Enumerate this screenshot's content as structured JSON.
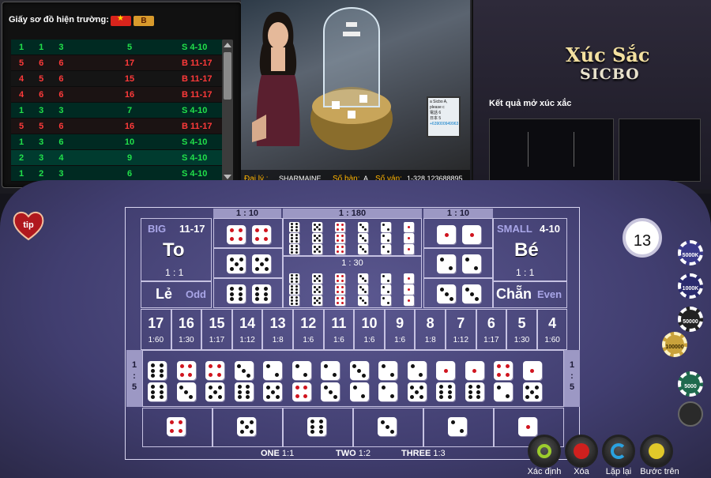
{
  "roadmap": {
    "title": "Giấy sơ đồ hiện trường:",
    "flag_b": "B",
    "rows": [
      {
        "dice": "1 1 3",
        "sum": "5",
        "cat": "S 4-10",
        "color": "g"
      },
      {
        "dice": "5 6 6",
        "sum": "17",
        "cat": "B 11-17",
        "color": "r"
      },
      {
        "dice": "4 5 6",
        "sum": "15",
        "cat": "B 11-17",
        "color": "r"
      },
      {
        "dice": "4 6 6",
        "sum": "16",
        "cat": "B 11-17",
        "color": "r"
      },
      {
        "dice": "1 3 3",
        "sum": "7",
        "cat": "S 4-10",
        "color": "g"
      },
      {
        "dice": "5 5 6",
        "sum": "16",
        "cat": "B 11-17",
        "color": "r"
      },
      {
        "dice": "1 3 6",
        "sum": "10",
        "cat": "S 4-10",
        "color": "g"
      },
      {
        "dice": "2 3 4",
        "sum": "9",
        "cat": "S 4-10",
        "color": "g"
      },
      {
        "dice": "1 2 3",
        "sum": "6",
        "cat": "S 4-10",
        "color": "g"
      }
    ]
  },
  "video": {
    "dealer_label": "Đại lý :",
    "dealer_name": "SHARMAINE",
    "table_label": "Số bàn:",
    "table_no": "A",
    "round_label": "Số ván:",
    "round_no": "1-328 123688895",
    "monitor_lines": [
      "a Sicbo A, please c",
      "電話 6",
      "日本 5",
      "+639000949963"
    ]
  },
  "brand": {
    "title": "Xúc Sắc",
    "subtitle": "SICBO",
    "results_label": "Kết quả mở xúc xắc"
  },
  "tip": {
    "label": "tip"
  },
  "board": {
    "odds_top_left": "1 : 10",
    "odds_top_mid": "1 : 180",
    "odds_top_right": "1 : 10",
    "odds_any_triple": "1 : 30",
    "big": {
      "en": "BIG",
      "range": "11-17",
      "vn": "To",
      "odds": "1 : 1"
    },
    "small": {
      "en": "SMALL",
      "range": "4-10",
      "vn": "Bé",
      "odds": "1 : 1"
    },
    "odd": {
      "vn": "Lẻ",
      "en": "Odd"
    },
    "even": {
      "vn": "Chẵn",
      "en": "Even"
    },
    "totals": [
      {
        "n": "17",
        "o": "1:60"
      },
      {
        "n": "16",
        "o": "1:30"
      },
      {
        "n": "15",
        "o": "1:17"
      },
      {
        "n": "14",
        "o": "1:12"
      },
      {
        "n": "13",
        "o": "1:8"
      },
      {
        "n": "12",
        "o": "1:6"
      },
      {
        "n": "11",
        "o": "1:6"
      },
      {
        "n": "10",
        "o": "1:6"
      },
      {
        "n": "9",
        "o": "1:6"
      },
      {
        "n": "8",
        "o": "1:8"
      },
      {
        "n": "7",
        "o": "1:12"
      },
      {
        "n": "6",
        "o": "1:17"
      },
      {
        "n": "5",
        "o": "1:30"
      },
      {
        "n": "4",
        "o": "1:60"
      }
    ],
    "side_odds_left": [
      "1",
      ":",
      "5"
    ],
    "side_odds_right": [
      "1",
      ":",
      "5"
    ],
    "single_labels": {
      "one": "ONE",
      "one_odds": "1:1",
      "two": "TWO",
      "two_odds": "1:2",
      "three": "THREE",
      "three_odds": "1:3"
    }
  },
  "timer": "13",
  "chips": [
    {
      "label": "5000K",
      "color": "#3a3a8a"
    },
    {
      "label": "1000K",
      "color": "#2b2b6e"
    },
    {
      "label": "50000",
      "color": "#222"
    },
    {
      "label": "100000",
      "color": "#c9a23b"
    },
    {
      "label": "5000",
      "color": "#1f6a4e"
    }
  ],
  "actions": {
    "confirm": "Xác định",
    "clear": "Xóa",
    "repeat": "Lặp lại",
    "previous": "Bước trên"
  }
}
